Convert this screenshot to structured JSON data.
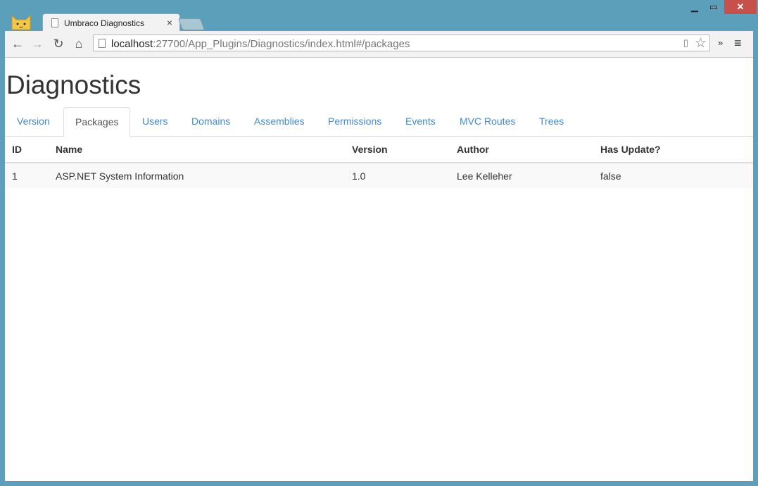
{
  "browser": {
    "tab_title": "Umbraco Diagnostics",
    "tab_close": "×",
    "url_host": "localhost",
    "url_rest": ":27700/App_Plugins/Diagnostics/index.html#/packages",
    "back_icon": "←",
    "forward_icon": "→",
    "reload_icon": "↻",
    "home_icon": "⌂",
    "star_icon": "☆",
    "extensions_icon": "»",
    "menu_icon": "≡",
    "minimize_icon": "▁",
    "maximize_icon": "▭",
    "close_icon": "✕"
  },
  "page": {
    "title": "Diagnostics",
    "tabs": [
      {
        "label": "Version"
      },
      {
        "label": "Packages"
      },
      {
        "label": "Users"
      },
      {
        "label": "Domains"
      },
      {
        "label": "Assemblies"
      },
      {
        "label": "Permissions"
      },
      {
        "label": "Events"
      },
      {
        "label": "MVC Routes"
      },
      {
        "label": "Trees"
      }
    ],
    "active_tab": "Packages"
  },
  "table": {
    "headers": [
      "ID",
      "Name",
      "Version",
      "Author",
      "Has Update?"
    ],
    "rows": [
      [
        "1",
        "ASP.NET System Information",
        "1.0",
        "Lee Kelleher",
        "false"
      ]
    ]
  },
  "colors": {
    "link": "#428bca",
    "frame": "#5b9fba",
    "close": "#c7504a"
  }
}
